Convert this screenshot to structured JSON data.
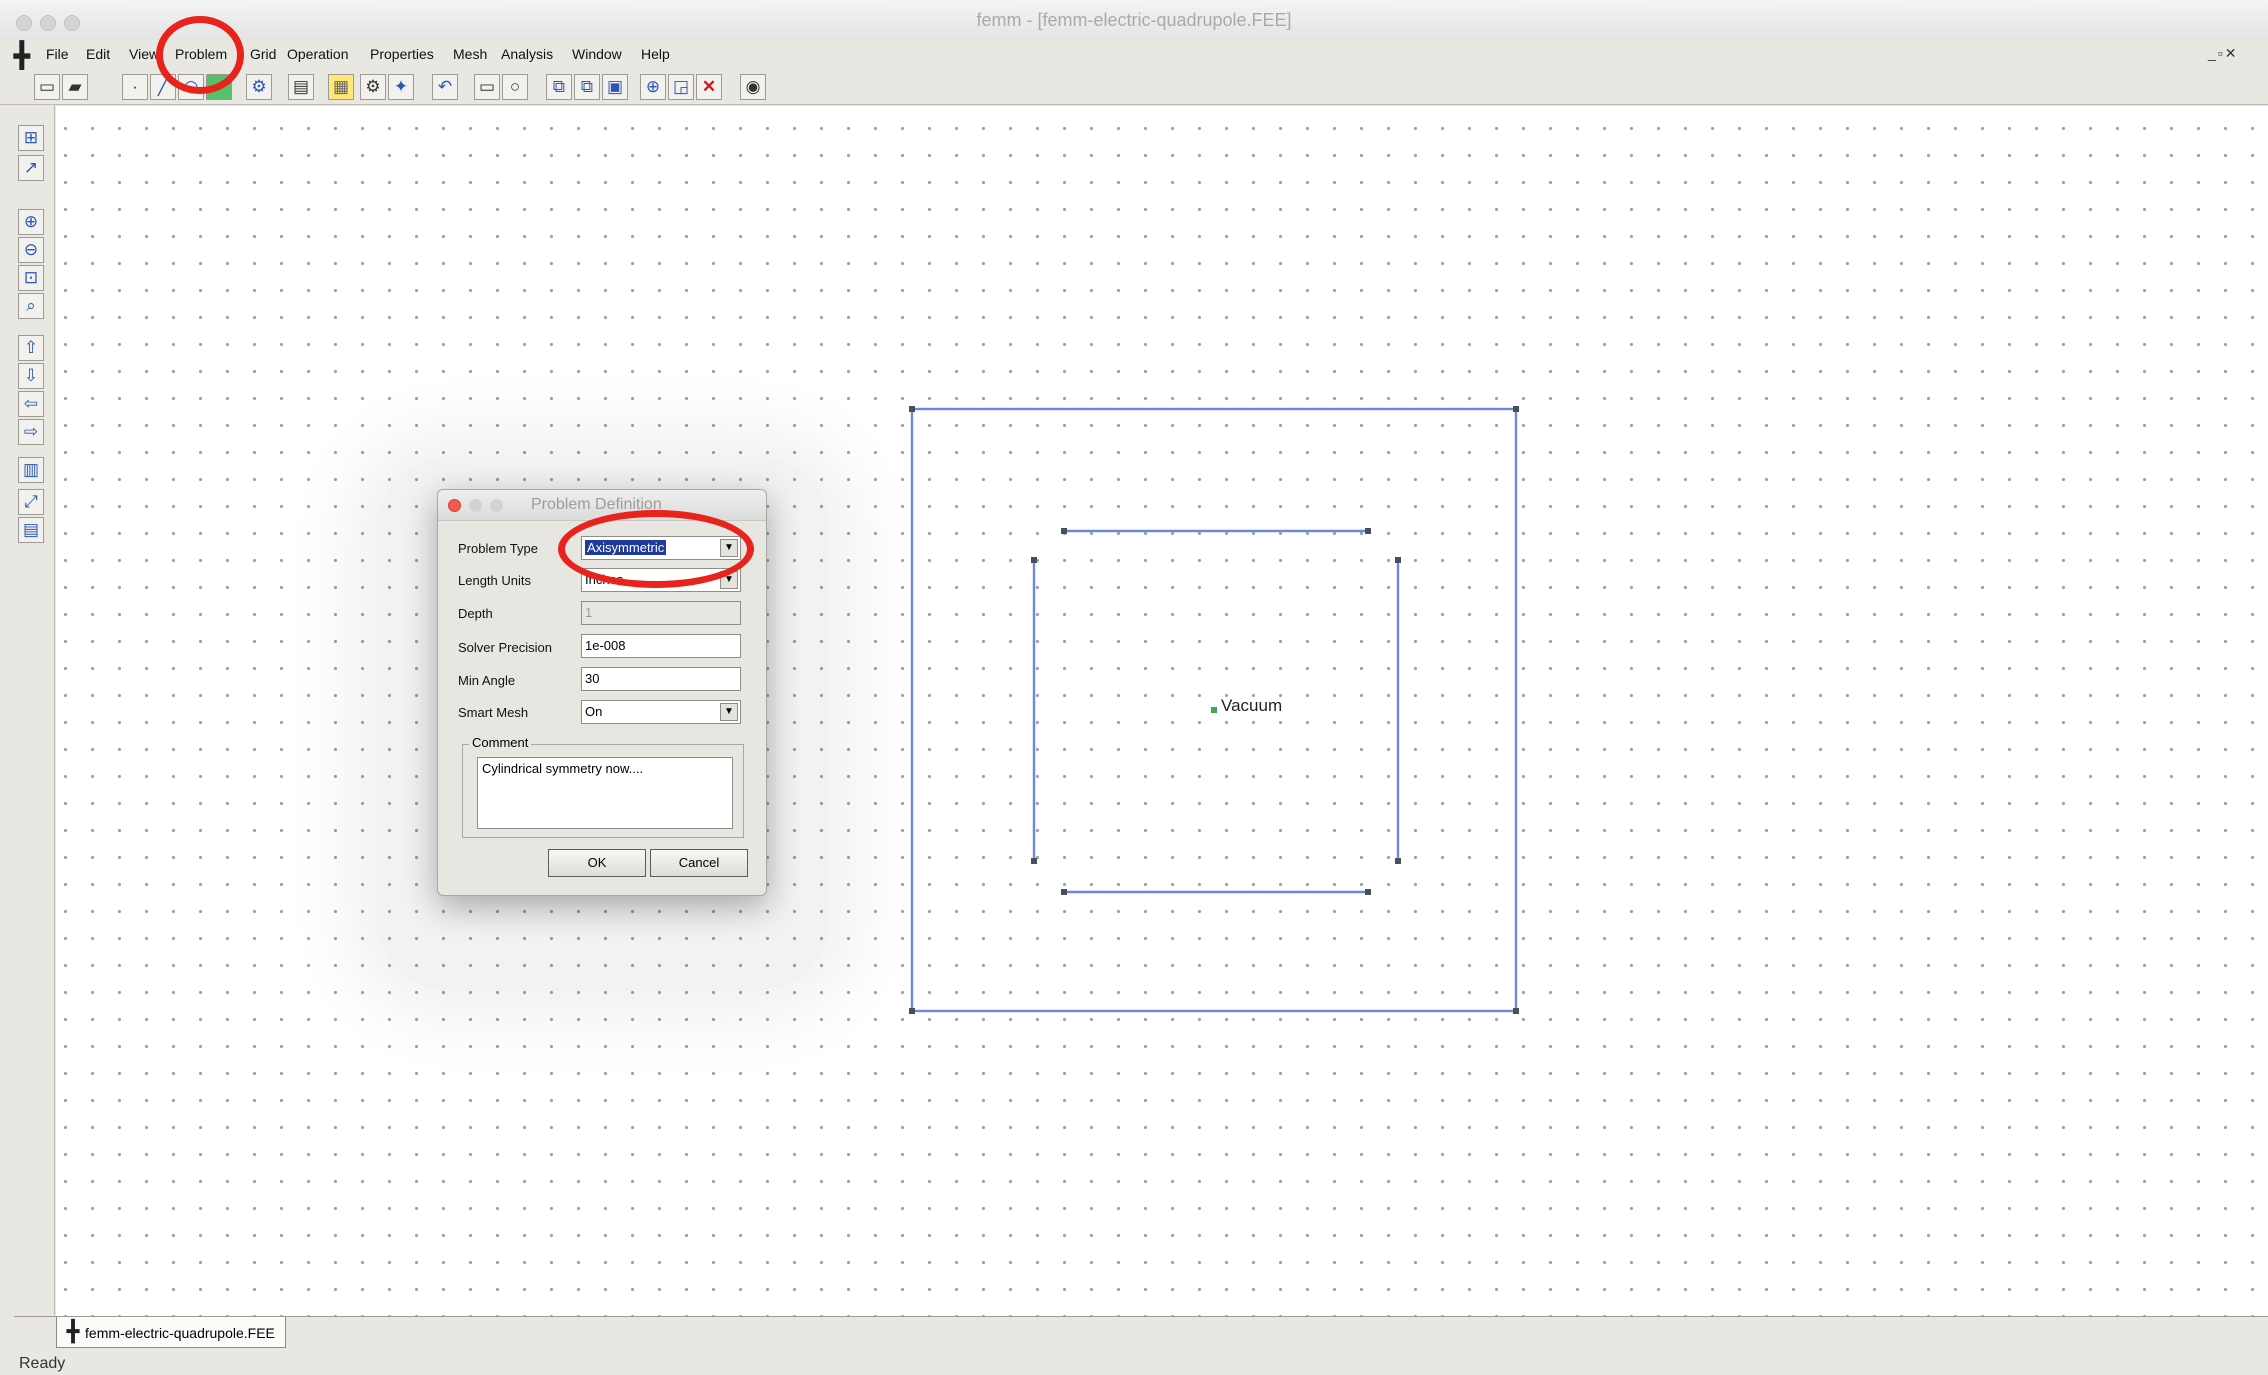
{
  "window": {
    "title": "femm - [femm-electric-quadrupole.FEE]"
  },
  "menubar": {
    "items": [
      "File",
      "Edit",
      "View",
      "Problem",
      "Grid",
      "Operation",
      "Properties",
      "Mesh",
      "Analysis",
      "Window",
      "Help"
    ]
  },
  "dialog": {
    "title": "Problem Definition",
    "fields": {
      "problem_type": {
        "label": "Problem Type",
        "value": "Axisymmetric"
      },
      "length_units": {
        "label": "Length Units",
        "value": "Inches"
      },
      "depth": {
        "label": "Depth",
        "value": "1"
      },
      "solver_precision": {
        "label": "Solver Precision",
        "value": "1e-008"
      },
      "min_angle": {
        "label": "Min Angle",
        "value": "30"
      },
      "smart_mesh": {
        "label": "Smart Mesh",
        "value": "On"
      }
    },
    "comment": {
      "label": "Comment",
      "value": "Cylindrical symmetry now...."
    },
    "buttons": {
      "ok": "OK",
      "cancel": "Cancel"
    }
  },
  "canvas": {
    "block_label": "Vacuum"
  },
  "tabs": {
    "document": "femm-electric-quadrupole.FEE"
  },
  "status": {
    "text": "Ready"
  },
  "colors": {
    "geometry": "#6b88e6",
    "annotation": "#e8231b",
    "selection": "#1f3b9b"
  }
}
